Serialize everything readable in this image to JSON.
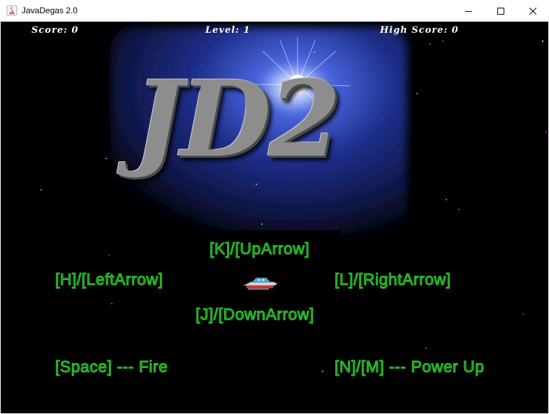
{
  "window": {
    "title": "JavaDegas 2.0",
    "controls": {
      "minimize": "minimize-icon",
      "maximize": "maximize-icon",
      "close": "close-icon"
    }
  },
  "hud": {
    "score_label": "Score:",
    "score_value": "0",
    "level_label": "Level:",
    "level_value": "1",
    "high_score_label": "High Score:",
    "high_score_value": "0"
  },
  "logo": {
    "text": "JD2"
  },
  "controls_help": {
    "up": "[K]/[UpArrow]",
    "left": "[H]/[LeftArrow]",
    "right": "[L]/[RightArrow]",
    "down": "[J]/[DownArrow]",
    "fire": "[Space] --- Fire",
    "power_up": "[N]/[M] --- Power Up"
  },
  "colors": {
    "background": "#000000",
    "hud_text": "#ffffff",
    "help_text": "#22aa22",
    "logo_glow": "#2a3aa8"
  }
}
